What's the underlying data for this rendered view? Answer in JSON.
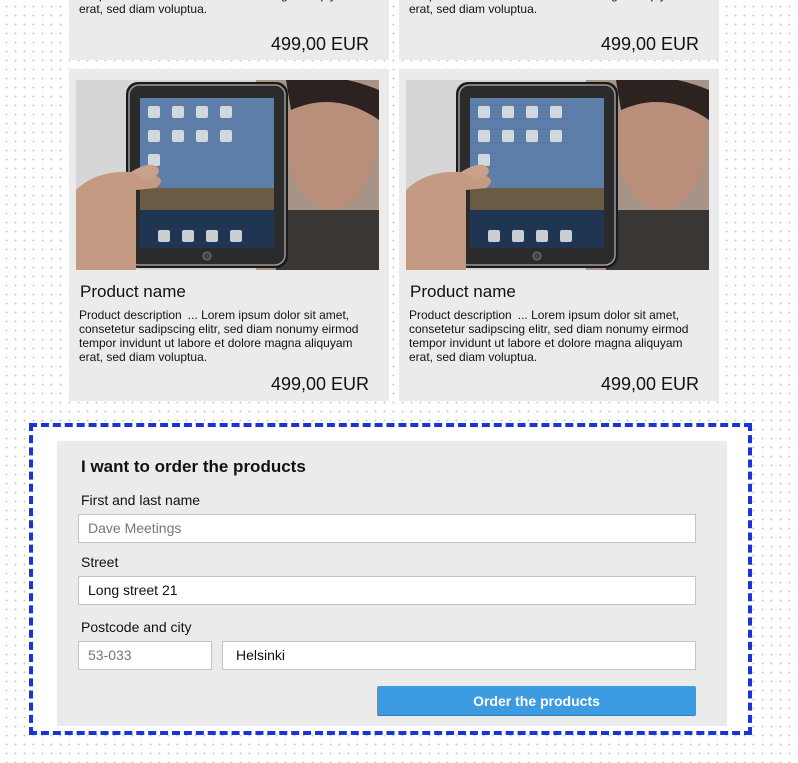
{
  "products_top": [
    {
      "desc_tail": "tempor invidunt ut labore et dolore magna aliquyam erat, sed diam voluptua.",
      "price": "499,00 EUR"
    },
    {
      "desc_tail": "tempor invidunt ut labore et dolore magna aliquyam erat, sed diam voluptua.",
      "price": "499,00 EUR"
    }
  ],
  "products": [
    {
      "name": "Product name",
      "desc_lead": "Product description",
      "desc": "... Lorem ipsum dolor sit amet, consetetur sadipscing elitr, sed diam nonumy eirmod tempor invidunt ut labore et dolore magna aliquyam erat, sed diam voluptua.",
      "price": "499,00 EUR"
    },
    {
      "name": "Product name",
      "desc_lead": "Product description",
      "desc": "... Lorem ipsum dolor sit amet, consetetur sadipscing elitr, sed diam nonumy eirmod tempor invidunt ut labore et dolore magna aliquyam erat, sed diam voluptua.",
      "price": "499,00 EUR"
    }
  ],
  "order": {
    "title": "I want to order the products",
    "name_label": "First and last name",
    "name_placeholder": "Dave Meetings",
    "street_label": "Street",
    "street_value": "Long street 21",
    "postcode_city_label": "Postcode and city",
    "postcode_placeholder": "53-033",
    "city_value": "Helsinki",
    "submit_label": "Order the products"
  },
  "colors": {
    "accent_button": "#3d9be2",
    "dashed_border": "#1a34d6",
    "card_bg": "#ebebeb"
  }
}
